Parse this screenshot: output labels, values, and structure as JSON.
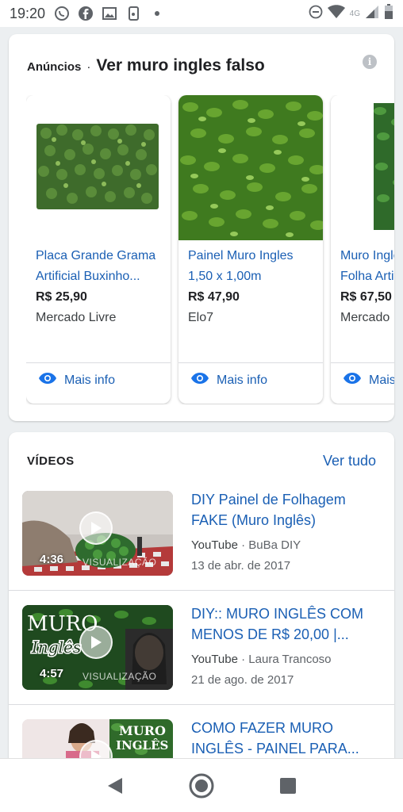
{
  "status_bar": {
    "time": "19:20",
    "network": "4G",
    "icons_left": [
      "whatsapp-icon",
      "facebook-icon",
      "gallery-icon",
      "phone-cast-icon",
      "dot-icon"
    ],
    "icons_right": [
      "dnd-icon",
      "wifi-icon",
      "signal-icon",
      "battery-icon"
    ]
  },
  "ads": {
    "label": "Anúncios",
    "separator": "·",
    "title": "Ver muro ingles falso",
    "products": [
      {
        "name_line1": "Placa Grande Grama",
        "name_line2": "Artificial Buxinho...",
        "price": "R$ 25,90",
        "store": "Mercado Livre",
        "more": "Mais info"
      },
      {
        "name_line1": "Painel Muro Ingles",
        "name_line2": "1,50 x 1,00m",
        "price": "R$ 47,90",
        "store": "Elo7",
        "more": "Mais info"
      },
      {
        "name_line1": "Muro Inglês",
        "name_line2": "Folha Artif",
        "price": "R$ 67,50",
        "store": "Mercado L",
        "more": "Mais"
      }
    ]
  },
  "videos": {
    "title": "VÍDEOS",
    "see_all": "Ver tudo",
    "items": [
      {
        "title_line1": "DIY Painel de Folhagem",
        "title_line2": "FAKE (Muro Inglês)",
        "source": "YouTube",
        "channel": "BuBa DIY",
        "date": "13 de abr. de 2017",
        "duration": "4:36",
        "overlay": "VISUALIZAÇÃO"
      },
      {
        "title_line1": "DIY:: MURO INGLÊS COM",
        "title_line2": "MENOS DE R$ 20,00 |...",
        "source": "YouTube",
        "channel": "Laura Trancoso",
        "date": "21 de ago. de 2017",
        "duration": "4:57",
        "overlay": "VISUALIZAÇÃO",
        "thumb_text1": "MURO",
        "thumb_text2": "Inglês"
      },
      {
        "title_line1": "COMO FAZER MURO",
        "title_line2": "INGLÊS - PAINEL PARA...",
        "thumb_text1": "MURO",
        "thumb_text2": "INGLÊS"
      }
    ]
  },
  "nav": {
    "buttons": [
      "back-icon",
      "home-icon",
      "recents-icon"
    ]
  }
}
